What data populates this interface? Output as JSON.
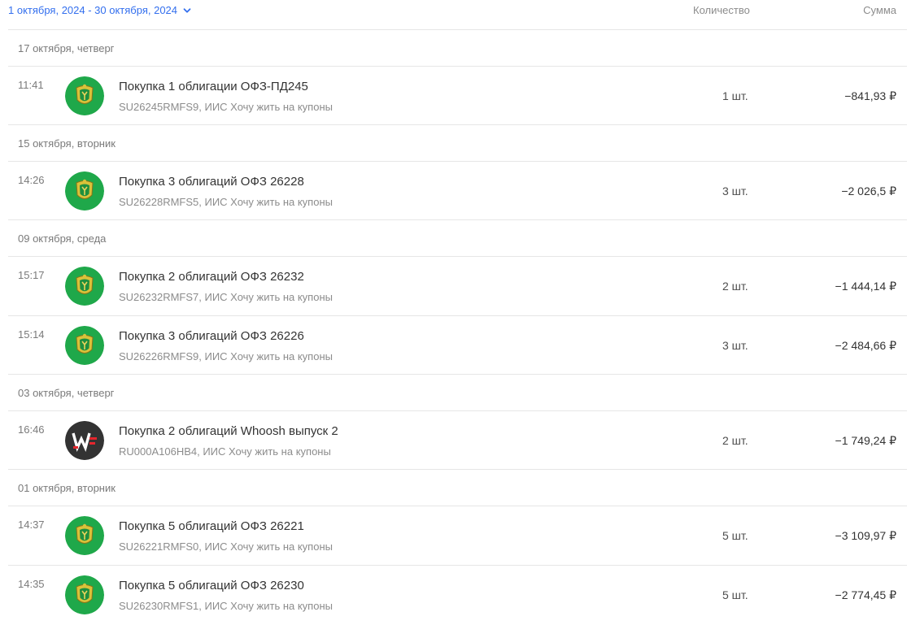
{
  "header": {
    "date_range": "1 октября, 2024 - 30 октября, 2024",
    "col_quantity": "Количество",
    "col_sum": "Сумма"
  },
  "colors": {
    "accent": "#336fee",
    "ofz_logo": "#1fa84a",
    "whoosh_logo": "#333333",
    "whoosh_mark": "#e5262d"
  },
  "groups": [
    {
      "date": "17 октября, четверг",
      "ops": [
        {
          "time": "11:41",
          "logo": "ofz-emblem-icon",
          "title": "Покупка 1 облигации ОФЗ-ПД245",
          "sub": "SU26245RMFS9, ИИС Хочу жить на купоны",
          "qty": "1 шт.",
          "sum": "−841,93 ₽"
        }
      ]
    },
    {
      "date": "15 октября, вторник",
      "ops": [
        {
          "time": "14:26",
          "logo": "ofz-emblem-icon",
          "title": "Покупка 3 облигаций ОФЗ 26228",
          "sub": "SU26228RMFS5, ИИС Хочу жить на купоны",
          "qty": "3 шт.",
          "sum": "−2 026,5 ₽"
        }
      ]
    },
    {
      "date": "09 октября, среда",
      "ops": [
        {
          "time": "15:17",
          "logo": "ofz-emblem-icon",
          "title": "Покупка 2 облигаций ОФЗ 26232",
          "sub": "SU26232RMFS7, ИИС Хочу жить на купоны",
          "qty": "2 шт.",
          "sum": "−1 444,14 ₽"
        },
        {
          "time": "15:14",
          "logo": "ofz-emblem-icon",
          "title": "Покупка 3 облигаций ОФЗ 26226",
          "sub": "SU26226RMFS9, ИИС Хочу жить на купоны",
          "qty": "3 шт.",
          "sum": "−2 484,66 ₽"
        }
      ]
    },
    {
      "date": "03 октября, четверг",
      "ops": [
        {
          "time": "16:46",
          "logo": "whoosh-logo-icon",
          "title": "Покупка 2 облигаций Whoosh выпуск 2",
          "sub": "RU000A106HB4, ИИС Хочу жить на купоны",
          "qty": "2 шт.",
          "sum": "−1 749,24 ₽"
        }
      ]
    },
    {
      "date": "01 октября, вторник",
      "ops": [
        {
          "time": "14:37",
          "logo": "ofz-emblem-icon",
          "title": "Покупка 5 облигаций ОФЗ 26221",
          "sub": "SU26221RMFS0, ИИС Хочу жить на купоны",
          "qty": "5 шт.",
          "sum": "−3 109,97 ₽"
        },
        {
          "time": "14:35",
          "logo": "ofz-emblem-icon",
          "title": "Покупка 5 облигаций ОФЗ 26230",
          "sub": "SU26230RMFS1, ИИС Хочу жить на купоны",
          "qty": "5 шт.",
          "sum": "−2 774,45 ₽"
        }
      ]
    }
  ]
}
